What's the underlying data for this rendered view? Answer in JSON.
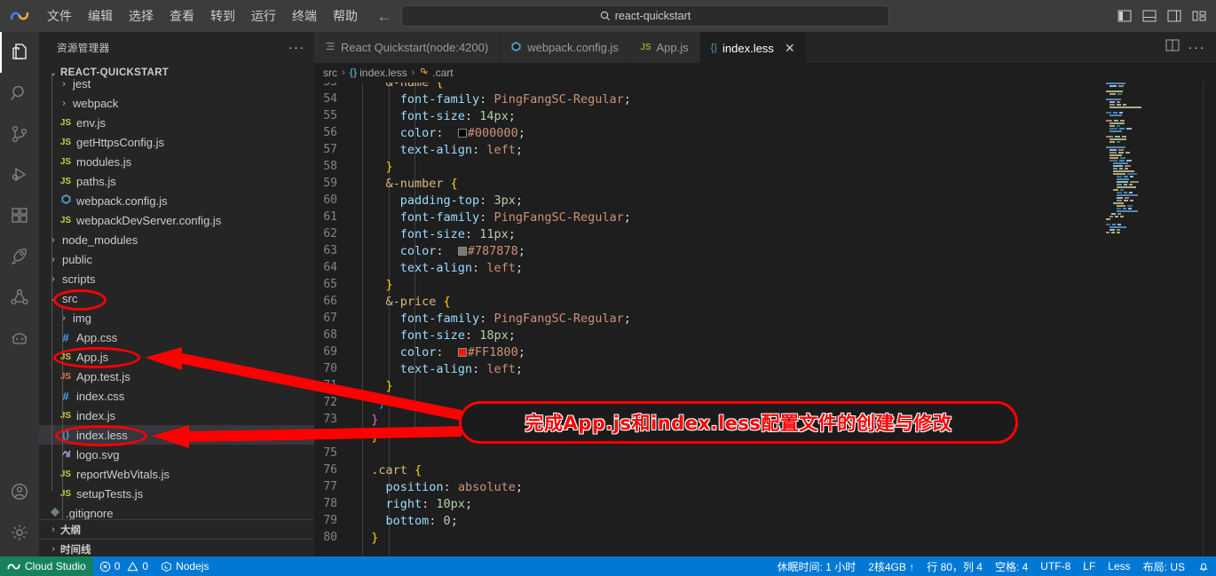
{
  "titlebar": {
    "logo_icon": "cloud-studio-logo",
    "menus": [
      "文件",
      "编辑",
      "选择",
      "查看",
      "转到",
      "运行",
      "终端",
      "帮助"
    ],
    "back_icon": "arrow-left-icon",
    "forward_icon": "arrow-right-icon",
    "search": {
      "icon": "search-icon",
      "value": "react-quickstart"
    },
    "layout_icons": [
      "toggle-primary-sidebar-icon",
      "toggle-panel-icon",
      "toggle-secondary-sidebar-icon",
      "customize-layout-icon"
    ]
  },
  "activitybar": {
    "items": [
      {
        "name": "explorer",
        "icon": "files-icon",
        "active": true
      },
      {
        "name": "search",
        "icon": "search-icon",
        "active": false
      },
      {
        "name": "source-control",
        "icon": "source-control-icon",
        "active": false
      },
      {
        "name": "run-and-debug",
        "icon": "run-debug-icon",
        "active": false
      },
      {
        "name": "extensions",
        "icon": "extensions-icon",
        "active": false
      },
      {
        "name": "deploy",
        "icon": "rocket-icon",
        "active": false
      },
      {
        "name": "share",
        "icon": "share-nodes-icon",
        "active": false
      },
      {
        "name": "ai-assistant",
        "icon": "robot-face-icon",
        "active": false
      }
    ],
    "bottom": [
      {
        "name": "accounts",
        "icon": "account-circle-icon"
      },
      {
        "name": "settings",
        "icon": "gear-icon"
      }
    ]
  },
  "sidebar": {
    "title": "资源管理器",
    "more_icon": "ellipsis-icon",
    "root_label": "REACT-QUICKSTART",
    "root_chevron": "chevron-down-icon",
    "tree": [
      {
        "label": "jest",
        "type": "folder",
        "indent": 1,
        "expanded": false,
        "icon": "chevron-right-icon",
        "clipped": true
      },
      {
        "label": "webpack",
        "type": "folder",
        "indent": 1,
        "expanded": false,
        "icon": "chevron-right-icon"
      },
      {
        "label": "env.js",
        "type": "file",
        "indent": 1,
        "icon": "js-icon"
      },
      {
        "label": "getHttpsConfig.js",
        "type": "file",
        "indent": 1,
        "icon": "js-icon"
      },
      {
        "label": "modules.js",
        "type": "file",
        "indent": 1,
        "icon": "js-icon"
      },
      {
        "label": "paths.js",
        "type": "file",
        "indent": 1,
        "icon": "js-icon"
      },
      {
        "label": "webpack.config.js",
        "type": "file",
        "indent": 1,
        "icon": "webpack-icon"
      },
      {
        "label": "webpackDevServer.config.js",
        "type": "file",
        "indent": 1,
        "icon": "js-icon"
      },
      {
        "label": "node_modules",
        "type": "folder",
        "indent": 0,
        "expanded": false,
        "icon": "chevron-right-icon"
      },
      {
        "label": "public",
        "type": "folder",
        "indent": 0,
        "expanded": false,
        "icon": "chevron-right-icon"
      },
      {
        "label": "scripts",
        "type": "folder",
        "indent": 0,
        "expanded": false,
        "icon": "chevron-right-icon"
      },
      {
        "label": "src",
        "type": "folder",
        "indent": 0,
        "expanded": true,
        "icon": "chevron-down-icon",
        "annotated": true
      },
      {
        "label": "img",
        "type": "folder",
        "indent": 1,
        "expanded": false,
        "icon": "chevron-right-icon"
      },
      {
        "label": "App.css",
        "type": "file",
        "indent": 1,
        "icon": "css-icon"
      },
      {
        "label": "App.js",
        "type": "file",
        "indent": 1,
        "icon": "js-icon",
        "annotated": true
      },
      {
        "label": "App.test.js",
        "type": "file",
        "indent": 1,
        "icon": "js-test-icon"
      },
      {
        "label": "index.css",
        "type": "file",
        "indent": 1,
        "icon": "css-icon"
      },
      {
        "label": "index.js",
        "type": "file",
        "indent": 1,
        "icon": "js-icon"
      },
      {
        "label": "index.less",
        "type": "file",
        "indent": 1,
        "icon": "less-icon",
        "selected": true,
        "annotated": true
      },
      {
        "label": "logo.svg",
        "type": "file",
        "indent": 1,
        "icon": "svg-icon"
      },
      {
        "label": "reportWebVitals.js",
        "type": "file",
        "indent": 1,
        "icon": "js-icon"
      },
      {
        "label": "setupTests.js",
        "type": "file",
        "indent": 1,
        "icon": "js-icon"
      },
      {
        "label": ".gitignore",
        "type": "file",
        "indent": 0,
        "icon": "git-icon",
        "clipped": true
      }
    ],
    "sections": [
      {
        "label": "大纲",
        "icon": "chevron-right-icon"
      },
      {
        "label": "时间线",
        "icon": "chevron-right-icon"
      }
    ]
  },
  "editor": {
    "tabs": [
      {
        "label": "React Quickstart(node:4200)",
        "icon": "terminal-list-icon",
        "active": false,
        "closable": false
      },
      {
        "label": "webpack.config.js",
        "icon": "webpack-icon",
        "active": false,
        "closable": false
      },
      {
        "label": "App.js",
        "icon": "js-icon",
        "active": false,
        "closable": false
      },
      {
        "label": "index.less",
        "icon": "less-icon",
        "active": true,
        "closable": true,
        "close_icon": "close-icon"
      }
    ],
    "tab_actions": [
      {
        "name": "split-editor-right",
        "icon": "split-editor-icon"
      },
      {
        "name": "more-actions",
        "icon": "ellipsis-icon"
      }
    ],
    "breadcrumb": [
      {
        "label": "src",
        "icon": null
      },
      {
        "label": "index.less",
        "icon": "less-icon"
      },
      {
        "label": ".cart",
        "icon": "css-rule-icon"
      }
    ],
    "breadcrumb_separator": "›",
    "first_visible_line": 53,
    "lines": [
      {
        "n": 53,
        "segs": [
          {
            "t": "    &-name ",
            "c": "sel"
          },
          {
            "t": "{",
            "c": "br1"
          }
        ],
        "clipped": true
      },
      {
        "n": 54,
        "segs": [
          {
            "t": "      font-family",
            "c": "prop"
          },
          {
            "t": ": ",
            "c": "punc"
          },
          {
            "t": "PingFangSC-Regular",
            "c": "val"
          },
          {
            "t": ";",
            "c": "punc"
          }
        ]
      },
      {
        "n": 55,
        "segs": [
          {
            "t": "      font-size",
            "c": "prop"
          },
          {
            "t": ": ",
            "c": "punc"
          },
          {
            "t": "14px",
            "c": "num"
          },
          {
            "t": ";",
            "c": "punc"
          }
        ]
      },
      {
        "n": 56,
        "segs": [
          {
            "t": "      color",
            "c": "prop"
          },
          {
            "t": ":  ",
            "c": "punc"
          },
          {
            "t": "#000000",
            "c": "val",
            "swatch": "#000000"
          },
          {
            "t": ";",
            "c": "punc"
          }
        ]
      },
      {
        "n": 57,
        "segs": [
          {
            "t": "      text-align",
            "c": "prop"
          },
          {
            "t": ": ",
            "c": "punc"
          },
          {
            "t": "left",
            "c": "val"
          },
          {
            "t": ";",
            "c": "punc"
          }
        ]
      },
      {
        "n": 58,
        "segs": [
          {
            "t": "    }",
            "c": "br1"
          }
        ]
      },
      {
        "n": 59,
        "segs": [
          {
            "t": "    &-number ",
            "c": "sel"
          },
          {
            "t": "{",
            "c": "br1"
          }
        ]
      },
      {
        "n": 60,
        "segs": [
          {
            "t": "      padding-top",
            "c": "prop"
          },
          {
            "t": ": ",
            "c": "punc"
          },
          {
            "t": "3px",
            "c": "num"
          },
          {
            "t": ";",
            "c": "punc"
          }
        ]
      },
      {
        "n": 61,
        "segs": [
          {
            "t": "      font-family",
            "c": "prop"
          },
          {
            "t": ": ",
            "c": "punc"
          },
          {
            "t": "PingFangSC-Regular",
            "c": "val"
          },
          {
            "t": ";",
            "c": "punc"
          }
        ]
      },
      {
        "n": 62,
        "segs": [
          {
            "t": "      font-size",
            "c": "prop"
          },
          {
            "t": ": ",
            "c": "punc"
          },
          {
            "t": "11px",
            "c": "num"
          },
          {
            "t": ";",
            "c": "punc"
          }
        ]
      },
      {
        "n": 63,
        "segs": [
          {
            "t": "      color",
            "c": "prop"
          },
          {
            "t": ":  ",
            "c": "punc"
          },
          {
            "t": "#787878",
            "c": "val",
            "swatch": "#787878"
          },
          {
            "t": ";",
            "c": "punc"
          }
        ]
      },
      {
        "n": 64,
        "segs": [
          {
            "t": "      text-align",
            "c": "prop"
          },
          {
            "t": ": ",
            "c": "punc"
          },
          {
            "t": "left",
            "c": "val"
          },
          {
            "t": ";",
            "c": "punc"
          }
        ]
      },
      {
        "n": 65,
        "segs": [
          {
            "t": "    }",
            "c": "br1"
          }
        ]
      },
      {
        "n": 66,
        "segs": [
          {
            "t": "    &-price ",
            "c": "sel"
          },
          {
            "t": "{",
            "c": "br1"
          }
        ]
      },
      {
        "n": 67,
        "segs": [
          {
            "t": "      font-family",
            "c": "prop"
          },
          {
            "t": ": ",
            "c": "punc"
          },
          {
            "t": "PingFangSC-Regular",
            "c": "val"
          },
          {
            "t": ";",
            "c": "punc"
          }
        ]
      },
      {
        "n": 68,
        "segs": [
          {
            "t": "      font-size",
            "c": "prop"
          },
          {
            "t": ": ",
            "c": "punc"
          },
          {
            "t": "18px",
            "c": "num"
          },
          {
            "t": ";",
            "c": "punc"
          }
        ]
      },
      {
        "n": 69,
        "segs": [
          {
            "t": "      color",
            "c": "prop"
          },
          {
            "t": ":  ",
            "c": "punc"
          },
          {
            "t": "#FF1800",
            "c": "val",
            "swatch": "#FF1800"
          },
          {
            "t": ";",
            "c": "punc"
          }
        ]
      },
      {
        "n": 70,
        "segs": [
          {
            "t": "      text-align",
            "c": "prop"
          },
          {
            "t": ": ",
            "c": "punc"
          },
          {
            "t": "left",
            "c": "val"
          },
          {
            "t": ";",
            "c": "punc"
          }
        ]
      },
      {
        "n": 71,
        "segs": [
          {
            "t": "    }",
            "c": "br1"
          }
        ]
      },
      {
        "n": 72,
        "segs": [
          {
            "t": "   }",
            "c": "br3"
          }
        ]
      },
      {
        "n": 73,
        "segs": [
          {
            "t": "  }",
            "c": "br2"
          }
        ]
      },
      {
        "n": 74,
        "segs": [
          {
            "t": "  }",
            "c": "br1"
          }
        ]
      },
      {
        "n": 75,
        "segs": [
          {
            "t": "",
            "c": "punc"
          }
        ]
      },
      {
        "n": 76,
        "segs": [
          {
            "t": "  .cart ",
            "c": "sel"
          },
          {
            "t": "{",
            "c": "br1"
          }
        ]
      },
      {
        "n": 77,
        "segs": [
          {
            "t": "    position",
            "c": "prop"
          },
          {
            "t": ": ",
            "c": "punc"
          },
          {
            "t": "absolute",
            "c": "val"
          },
          {
            "t": ";",
            "c": "punc"
          }
        ]
      },
      {
        "n": 78,
        "segs": [
          {
            "t": "    right",
            "c": "prop"
          },
          {
            "t": ": ",
            "c": "punc"
          },
          {
            "t": "10px",
            "c": "num"
          },
          {
            "t": ";",
            "c": "punc"
          }
        ]
      },
      {
        "n": 79,
        "segs": [
          {
            "t": "    bottom",
            "c": "prop"
          },
          {
            "t": ": ",
            "c": "punc"
          },
          {
            "t": "0",
            "c": "num"
          },
          {
            "t": ";",
            "c": "punc"
          }
        ]
      },
      {
        "n": 80,
        "segs": [
          {
            "t": "  }",
            "c": "br1"
          }
        ]
      }
    ]
  },
  "annotation": {
    "callout_text": "完成App.js和index.less配置文件的创建与修改",
    "color": "#ff0000",
    "ellipses": [
      "src",
      "App.js",
      "index.less"
    ],
    "arrows": [
      "arrow-to-app-js",
      "arrow-to-index-less"
    ]
  },
  "statusbar": {
    "cloud_studio": {
      "label": "Cloud Studio",
      "icon": "cloud-studio-logo"
    },
    "problems": {
      "errors_icon": "error-circle-icon",
      "errors": "0",
      "warnings_icon": "warning-triangle-icon",
      "warnings": "0"
    },
    "runtime": {
      "icon": "nodejs-icon",
      "label": "Nodejs"
    },
    "right_items": [
      {
        "name": "sleep-time",
        "label": "休眠时间: 1 小时"
      },
      {
        "name": "machine-spec",
        "label": "2核4GB ↑"
      },
      {
        "name": "cursor-position",
        "label": "行 80，列 4"
      },
      {
        "name": "indentation",
        "label": "空格: 4"
      },
      {
        "name": "encoding",
        "label": "UTF-8"
      },
      {
        "name": "eol",
        "label": "LF"
      },
      {
        "name": "language-mode",
        "label": "Less"
      },
      {
        "name": "keyboard-layout",
        "label": "布局: US"
      }
    ],
    "bell_icon": "bell-icon"
  }
}
